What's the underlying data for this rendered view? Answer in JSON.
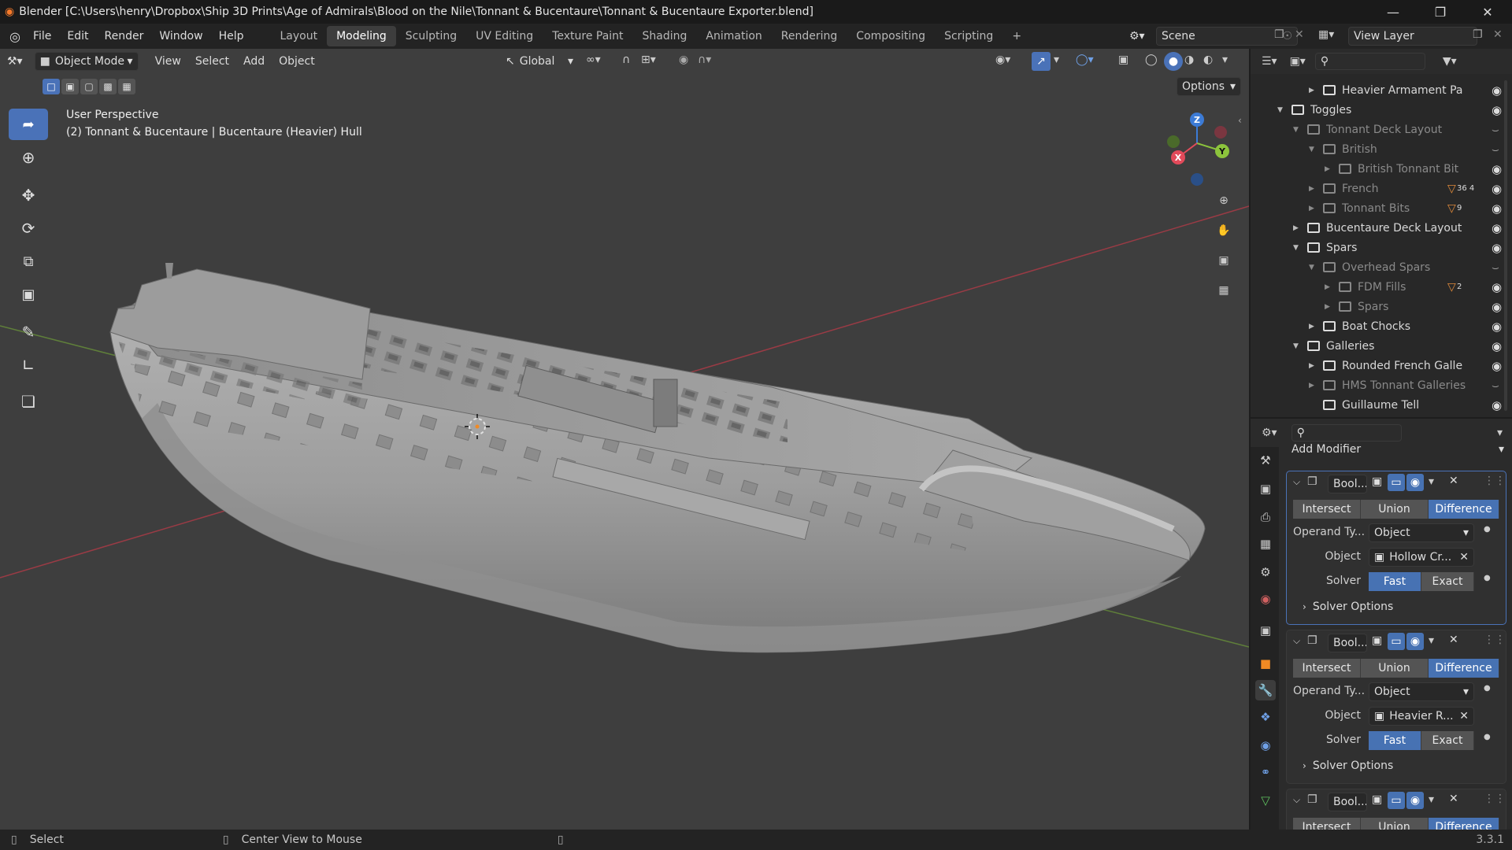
{
  "window": {
    "title": "Blender [C:\\Users\\henry\\Dropbox\\Ship 3D Prints\\Age of Admirals\\Blood on the Nile\\Tonnant & Bucentaure\\Tonnant & Bucentaure Exporter.blend]"
  },
  "menubar": {
    "items": [
      "File",
      "Edit",
      "Render",
      "Window",
      "Help"
    ]
  },
  "workspaces": [
    "Layout",
    "Modeling",
    "Sculpting",
    "UV Editing",
    "Texture Paint",
    "Shading",
    "Animation",
    "Rendering",
    "Compositing",
    "Scripting",
    "+"
  ],
  "active_workspace": "Modeling",
  "scene": {
    "name": "Scene",
    "view_layer": "View Layer"
  },
  "viewport_header": {
    "mode": "Object Mode",
    "menus": [
      "View",
      "Select",
      "Add",
      "Object"
    ],
    "orientation": "Global",
    "options": "Options"
  },
  "viewport": {
    "perspective": "User Perspective",
    "object_info": "(2) Tonnant & Bucentaure | Bucentaure (Heavier) Hull",
    "gizmo": {
      "x": "X",
      "y": "Y",
      "z": "Z"
    }
  },
  "tools": [
    "select-box",
    "cursor",
    "move",
    "rotate",
    "scale",
    "transform",
    "annotate",
    "measure",
    "add-cube"
  ],
  "outliner": {
    "rows": [
      {
        "label": "Heavier Armament Pa",
        "depth": 3,
        "expand": "collapsed",
        "visible": true,
        "dimmed": false
      },
      {
        "label": "Toggles",
        "depth": 1,
        "expand": "expanded",
        "visible": true,
        "dimmed": false
      },
      {
        "label": "Tonnant Deck Layout",
        "depth": 2,
        "expand": "expanded",
        "visible": false,
        "dimmed": true
      },
      {
        "label": "British",
        "depth": 3,
        "expand": "expanded",
        "visible": false,
        "dimmed": true
      },
      {
        "label": "British Tonnant Bit",
        "depth": 4,
        "expand": "collapsed",
        "visible": true,
        "dimmed": true
      },
      {
        "label": "French",
        "depth": 3,
        "expand": "collapsed",
        "visible": true,
        "dimmed": true,
        "badge": "36 4"
      },
      {
        "label": "Tonnant Bits",
        "depth": 3,
        "expand": "collapsed",
        "visible": true,
        "dimmed": true,
        "badge": "9"
      },
      {
        "label": "Bucentaure Deck Layout",
        "depth": 2,
        "expand": "collapsed",
        "visible": true,
        "dimmed": false
      },
      {
        "label": "Spars",
        "depth": 2,
        "expand": "expanded",
        "visible": true,
        "dimmed": false
      },
      {
        "label": "Overhead Spars",
        "depth": 3,
        "expand": "expanded",
        "visible": false,
        "dimmed": true
      },
      {
        "label": "FDM Fills",
        "depth": 4,
        "expand": "collapsed",
        "visible": true,
        "dimmed": true,
        "badge": "2"
      },
      {
        "label": "Spars",
        "depth": 4,
        "expand": "collapsed",
        "visible": true,
        "dimmed": true
      },
      {
        "label": "Boat Chocks",
        "depth": 3,
        "expand": "collapsed",
        "visible": true,
        "dimmed": false
      },
      {
        "label": "Galleries",
        "depth": 2,
        "expand": "expanded",
        "visible": true,
        "dimmed": false
      },
      {
        "label": "Rounded French Galle",
        "depth": 3,
        "expand": "collapsed",
        "visible": true,
        "dimmed": false
      },
      {
        "label": "HMS Tonnant Galleries",
        "depth": 3,
        "expand": "collapsed",
        "visible": false,
        "dimmed": true
      },
      {
        "label": "Guillaume Tell",
        "depth": 3,
        "expand": "none",
        "visible": true,
        "dimmed": false
      }
    ]
  },
  "properties": {
    "add_modifier": "Add Modifier",
    "modifiers": [
      {
        "name": "Bool...",
        "operations": [
          "Intersect",
          "Union",
          "Difference"
        ],
        "active_op": "Difference",
        "operand_label": "Operand Ty...",
        "operand_value": "Object",
        "object_label": "Object",
        "object_value": "Hollow Cr...",
        "solver_label": "Solver",
        "solvers": [
          "Fast",
          "Exact"
        ],
        "active_solver": "Fast",
        "solver_options": "Solver Options"
      },
      {
        "name": "Bool...",
        "operations": [
          "Intersect",
          "Union",
          "Difference"
        ],
        "active_op": "Difference",
        "operand_label": "Operand Ty...",
        "operand_value": "Object",
        "object_label": "Object",
        "object_value": "Heavier R...",
        "solver_label": "Solver",
        "solvers": [
          "Fast",
          "Exact"
        ],
        "active_solver": "Fast",
        "solver_options": "Solver Options"
      },
      {
        "name": "Bool...",
        "operations": [
          "Intersect",
          "Union",
          "Difference"
        ],
        "active_op": "Difference"
      }
    ]
  },
  "statusbar": {
    "left": "Select",
    "middle": "Center View to Mouse",
    "version": "3.3.1"
  },
  "colors": {
    "accent": "#4772b3",
    "viewport_bg": "#3e3e3e",
    "axis_x": "#e24a5a",
    "axis_y": "#8cc43c",
    "axis_z": "#3c7bd6"
  }
}
